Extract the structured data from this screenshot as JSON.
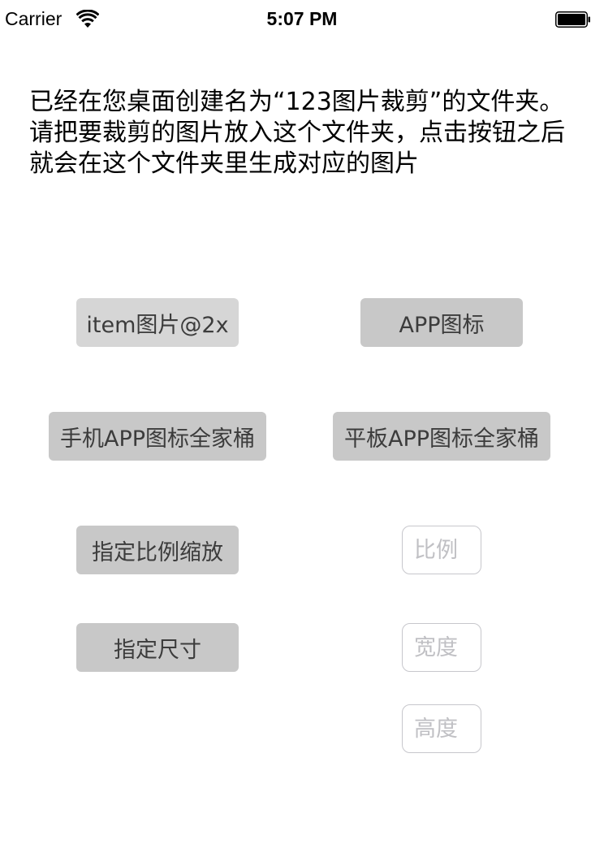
{
  "status_bar": {
    "carrier": "Carrier",
    "time": "5:07 PM",
    "wifi_icon": "wifi-icon",
    "battery_icon": "battery-icon"
  },
  "description": "已经在您桌面创建名为“123图片裁剪”的文件夹。请把要裁剪的图片放入这个文件夹，点击按钮之后就会在这个文件夹里生成对应的图片",
  "buttons": {
    "item_2x": "item图片@2x",
    "app_icon": "APP图标",
    "phone_app_icons": "手机APP图标全家桶",
    "pad_app_icons": "平板APP图标全家桶",
    "scale_ratio": "指定比例缩放",
    "fixed_size": "指定尺寸"
  },
  "inputs": {
    "ratio": {
      "placeholder": "比例",
      "value": ""
    },
    "width": {
      "placeholder": "宽度",
      "value": ""
    },
    "height": {
      "placeholder": "高度",
      "value": ""
    }
  },
  "colors": {
    "button_bg": "#c8c8c8",
    "button_bg_light": "#d6d6d6",
    "button_text": "#3c3c3c",
    "field_border": "#c7c7cc",
    "placeholder": "#c0c0c4"
  }
}
